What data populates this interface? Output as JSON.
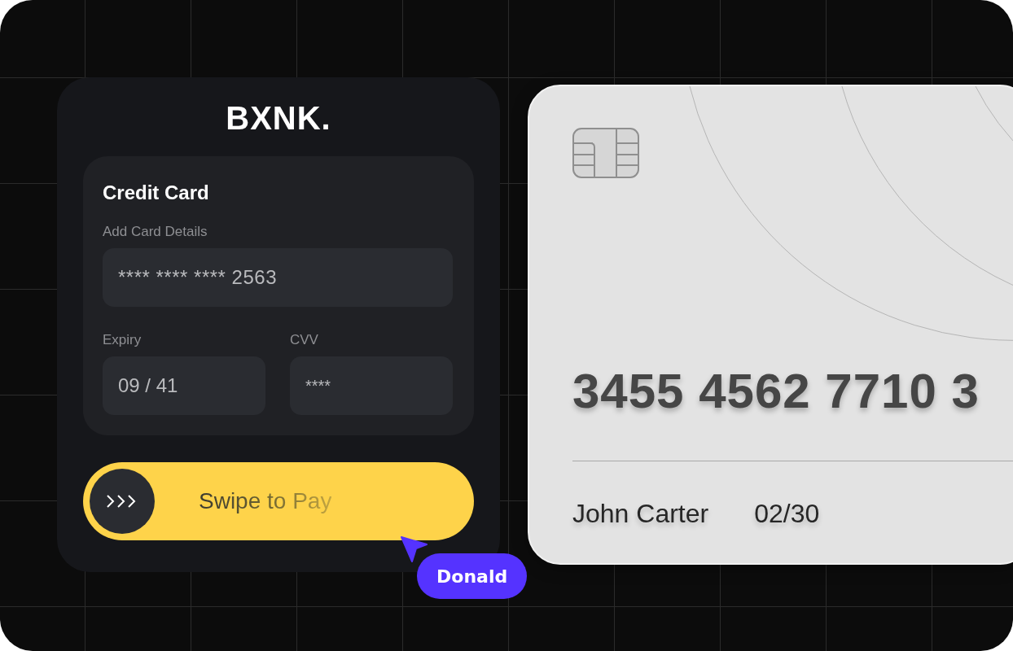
{
  "logo": {
    "text": "BXNK."
  },
  "form": {
    "title": "Credit Card",
    "section_label": "Add Card Details",
    "card_number": {
      "value": "**** **** **** 2563"
    },
    "expiry": {
      "label": "Expiry",
      "value": "09 / 41"
    },
    "cvv": {
      "label": "CVV",
      "value": "****"
    }
  },
  "swipe_button": {
    "label": "Swipe to Pay"
  },
  "cursor": {
    "name": "Donald"
  },
  "card": {
    "number": "3455 4562 7710 3",
    "holder": "John Carter",
    "expiry": "02/30"
  }
}
